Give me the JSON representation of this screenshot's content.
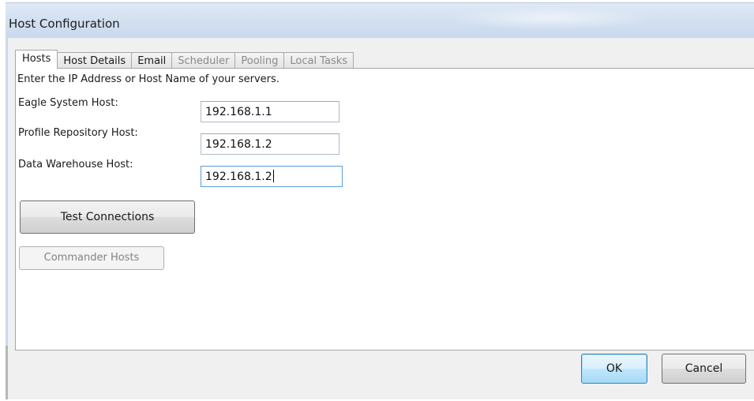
{
  "window": {
    "title": "Host Configuration"
  },
  "tabs": [
    {
      "label": "Hosts",
      "state": "active"
    },
    {
      "label": "Host Details",
      "state": "enabled"
    },
    {
      "label": "Email",
      "state": "enabled"
    },
    {
      "label": "Scheduler",
      "state": "disabled"
    },
    {
      "label": "Pooling",
      "state": "disabled"
    },
    {
      "label": "Local Tasks",
      "state": "disabled"
    }
  ],
  "hosts_panel": {
    "instruction": "Enter the IP Address or Host Name of your servers.",
    "fields": [
      {
        "label": "Eagle System Host:",
        "value": "192.168.1.1"
      },
      {
        "label": "Profile Repository Host:",
        "value": "192.168.1.2"
      },
      {
        "label": "Data Warehouse Host:",
        "value": "192.168.1.2",
        "focused": true
      }
    ],
    "test_connections_label": "Test Connections",
    "commander_hosts_label": "Commander Hosts"
  },
  "footer": {
    "ok_label": "OK",
    "cancel_label": "Cancel"
  },
  "colors": {
    "titlebar": "#d3e1f1",
    "client_background": "#f0f0f0",
    "panel_background": "#ffffff",
    "default_button_border": "#3c7fb1",
    "disabled_text": "#838383"
  }
}
